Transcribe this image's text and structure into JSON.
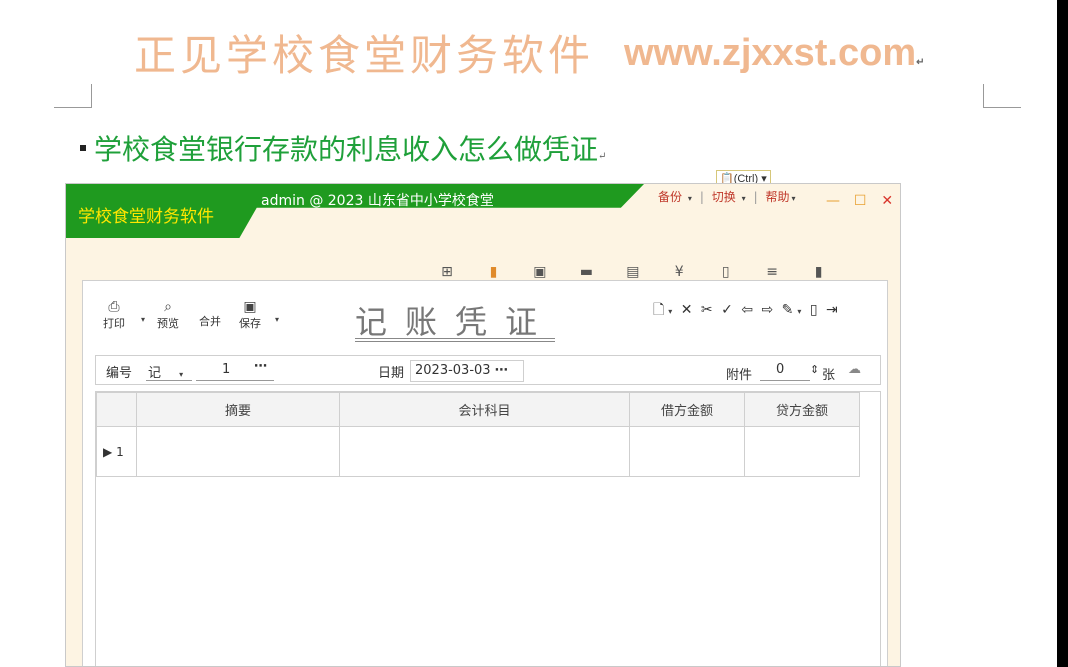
{
  "doc": {
    "title_cn": "正见学校食堂财务软件",
    "title_url": "www.zjxxst.com",
    "heading": "学校食堂银行存款的利息收入怎么做凭证",
    "paste_tag": "(Ctrl) ▾"
  },
  "app": {
    "name": "学校食堂财务软件",
    "user_line": "admin @ 2023 山东省中小学校食堂",
    "menus": [
      "备份",
      "切换",
      "帮助"
    ],
    "controls": [
      "—",
      "☐",
      "✕"
    ]
  },
  "toolbar": {
    "print": "打印",
    "preview": "预览",
    "merge": "合并",
    "save": "保存"
  },
  "voucher": {
    "title": "记账凭证",
    "number_label": "编号",
    "type_value": "记",
    "number_value": "1",
    "date_label": "日期",
    "date_value": "2023-03-03",
    "attach_label": "附件",
    "attach_value": "0",
    "attach_unit": "张"
  },
  "grid": {
    "columns": [
      "摘要",
      "会计科目",
      "借方金额",
      "贷方金额"
    ],
    "rows": [
      {
        "num": "1",
        "summary": "",
        "account": "",
        "debit": "",
        "credit": ""
      }
    ]
  },
  "icons": {
    "print": "printer-icon",
    "preview": "preview-icon",
    "save": "save-icon"
  }
}
